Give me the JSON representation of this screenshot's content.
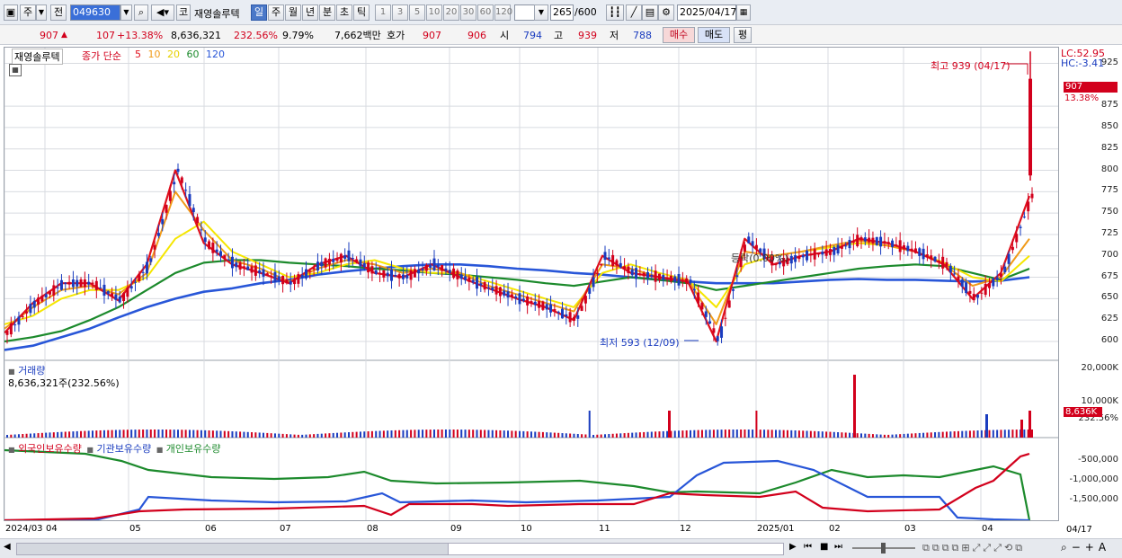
{
  "toolbar": {
    "market_btn": "주",
    "period_btn": "전",
    "code": "049630",
    "kospi_btn": "코",
    "stock_name": "재영솔루텍",
    "tabs": [
      "일",
      "주",
      "월",
      "년",
      "분",
      "초",
      "틱"
    ],
    "active_tab": "일",
    "intervals": [
      "1",
      "3",
      "5",
      "10",
      "20",
      "30",
      "60",
      "120"
    ],
    "count": "265",
    "count_total": "/600",
    "date": "2025/04/17"
  },
  "quote": {
    "price": "907",
    "change": "107",
    "change_pct": "+13.38%",
    "volume": "8,636,321",
    "volume_pct": "232.56%",
    "turnover": "9.79%",
    "amount": "7,662백만",
    "hoga_label": "호가",
    "ask": "907",
    "bid": "906",
    "open_label": "시",
    "open": "794",
    "high_label": "고",
    "high": "939",
    "low_label": "저",
    "low": "788",
    "buy_btn": "매수",
    "sell_btn": "매도",
    "eval_btn": "평"
  },
  "price_panel": {
    "name_tag": "재영솔루텍",
    "ma_label": "종가 단순",
    "ma_periods": [
      "5",
      "10",
      "20",
      "60",
      "120"
    ],
    "lc": "LC:52.95",
    "hc": "HC:-3.41",
    "current": "907",
    "current_pct": "13.38%",
    "high_note": "최고 939 (04/17)",
    "low_note": "최저 593 (12/09)",
    "mid_note": "등락(0.00%)",
    "top_tick": "925"
  },
  "volume_panel": {
    "title": "거래량",
    "value": "8,636,321주(232.56%)",
    "current": "8,636K",
    "current_pct": "232.56%",
    "tick_top": "20,000K",
    "tick_mid": "10,000K"
  },
  "holding_panel": {
    "legend": [
      "외국인보유수량",
      "기관보유수량",
      "개인보유수량"
    ],
    "ticks": [
      "-500,000",
      "-1,000,000",
      "-1,500,000"
    ]
  },
  "x_axis": {
    "labels": [
      "2024/03",
      "04",
      "05",
      "06",
      "07",
      "08",
      "09",
      "10",
      "11",
      "12",
      "2025/01",
      "02",
      "03",
      "04"
    ],
    "last_date": "04/17"
  },
  "colors": {
    "up": "#d2001c",
    "down": "#1a3cbf",
    "ma5": "#e0101c",
    "ma10": "#f09a18",
    "ma20": "#f5e600",
    "ma60": "#1c8a2c",
    "ma120": "#2856d8"
  },
  "chart_data": {
    "type": "line",
    "y_ticks": [
      600,
      625,
      650,
      675,
      700,
      725,
      750,
      775,
      800,
      825,
      850,
      875,
      925
    ],
    "ylim": [
      580,
      935
    ],
    "series": [
      {
        "name": "5",
        "values": [
          610,
          645,
          668,
          668,
          648,
          690,
          800,
          715,
          690,
          680,
          668,
          690,
          700,
          680,
          675,
          690,
          675,
          662,
          650,
          640,
          625,
          700,
          680,
          675,
          670,
          600,
          720,
          690,
          700,
          705,
          720,
          715,
          705,
          690,
          650,
          680,
          770
        ]
      },
      {
        "name": "10",
        "values": [
          615,
          640,
          660,
          665,
          655,
          680,
          775,
          730,
          695,
          685,
          670,
          685,
          695,
          690,
          680,
          685,
          680,
          665,
          655,
          645,
          635,
          690,
          685,
          675,
          672,
          620,
          705,
          700,
          705,
          712,
          718,
          712,
          705,
          690,
          665,
          675,
          720
        ]
      },
      {
        "name": "20",
        "values": [
          620,
          630,
          650,
          660,
          660,
          675,
          720,
          740,
          705,
          690,
          675,
          680,
          690,
          695,
          685,
          680,
          680,
          670,
          660,
          650,
          640,
          680,
          690,
          680,
          672,
          640,
          690,
          700,
          705,
          710,
          715,
          712,
          705,
          692,
          675,
          670,
          700
        ]
      },
      {
        "name": "60",
        "values": [
          600,
          605,
          612,
          625,
          640,
          660,
          680,
          692,
          695,
          695,
          692,
          690,
          688,
          685,
          683,
          680,
          678,
          675,
          672,
          668,
          665,
          670,
          675,
          672,
          668,
          660,
          665,
          670,
          675,
          680,
          685,
          688,
          690,
          688,
          680,
          672,
          685
        ]
      },
      {
        "name": "120",
        "values": [
          590,
          595,
          605,
          615,
          628,
          640,
          650,
          658,
          662,
          668,
          672,
          678,
          682,
          685,
          688,
          690,
          690,
          688,
          685,
          683,
          680,
          678,
          675,
          672,
          670,
          668,
          668,
          668,
          670,
          672,
          673,
          672,
          672,
          671,
          670,
          671,
          675
        ]
      }
    ]
  }
}
